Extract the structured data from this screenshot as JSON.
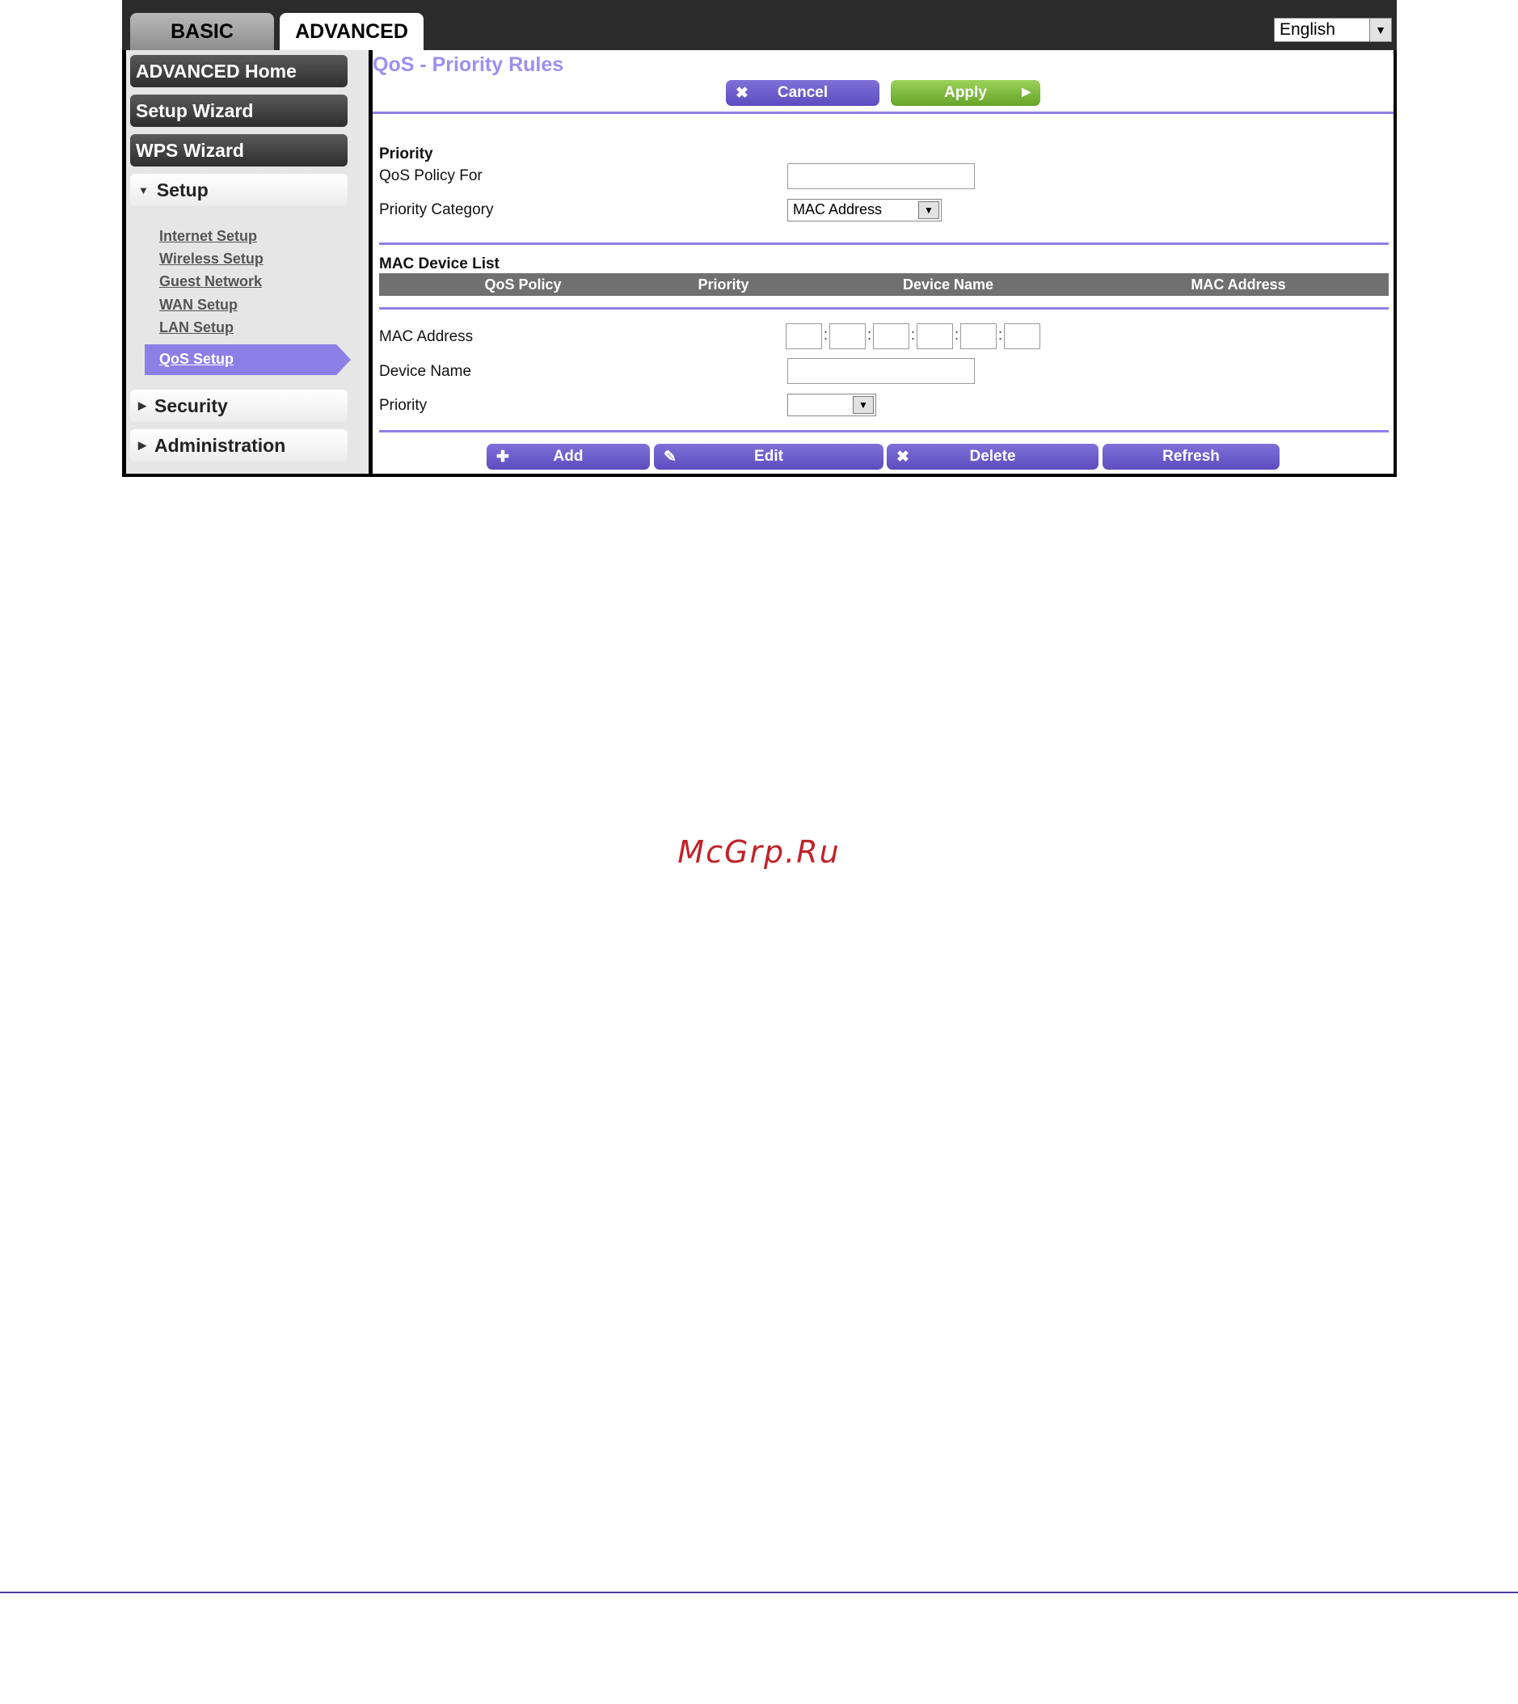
{
  "tabs": {
    "basic": "BASIC",
    "advanced": "ADVANCED"
  },
  "language": {
    "selected": "English"
  },
  "sidebar": {
    "advanced_home": "ADVANCED Home",
    "setup_wizard": "Setup Wizard",
    "wps_wizard": "WPS Wizard",
    "setup_section": "Setup",
    "setup_links": [
      "Internet Setup",
      "Wireless Setup",
      "Guest Network",
      "WAN Setup",
      "LAN Setup",
      "QoS Setup"
    ],
    "security_section": "Security",
    "administration_section": "Administration"
  },
  "page": {
    "title": "QoS - Priority Rules",
    "cancel": "Cancel",
    "apply": "Apply"
  },
  "priority_form": {
    "heading": "Priority",
    "policy_for_label": "QoS Policy For",
    "policy_for_value": "",
    "category_label": "Priority Category",
    "category_value": "MAC Address"
  },
  "mac_list": {
    "heading": "MAC Device List",
    "columns": [
      "QoS Policy",
      "Priority",
      "Device Name",
      "MAC Address"
    ],
    "rows": []
  },
  "mac_form": {
    "mac_label": "MAC Address",
    "device_name_label": "Device Name",
    "priority_label": "Priority",
    "priority_value": ""
  },
  "actions": {
    "add": "Add",
    "edit": "Edit",
    "delete": "Delete",
    "refresh": "Refresh"
  },
  "watermark": "McGrp.Ru"
}
